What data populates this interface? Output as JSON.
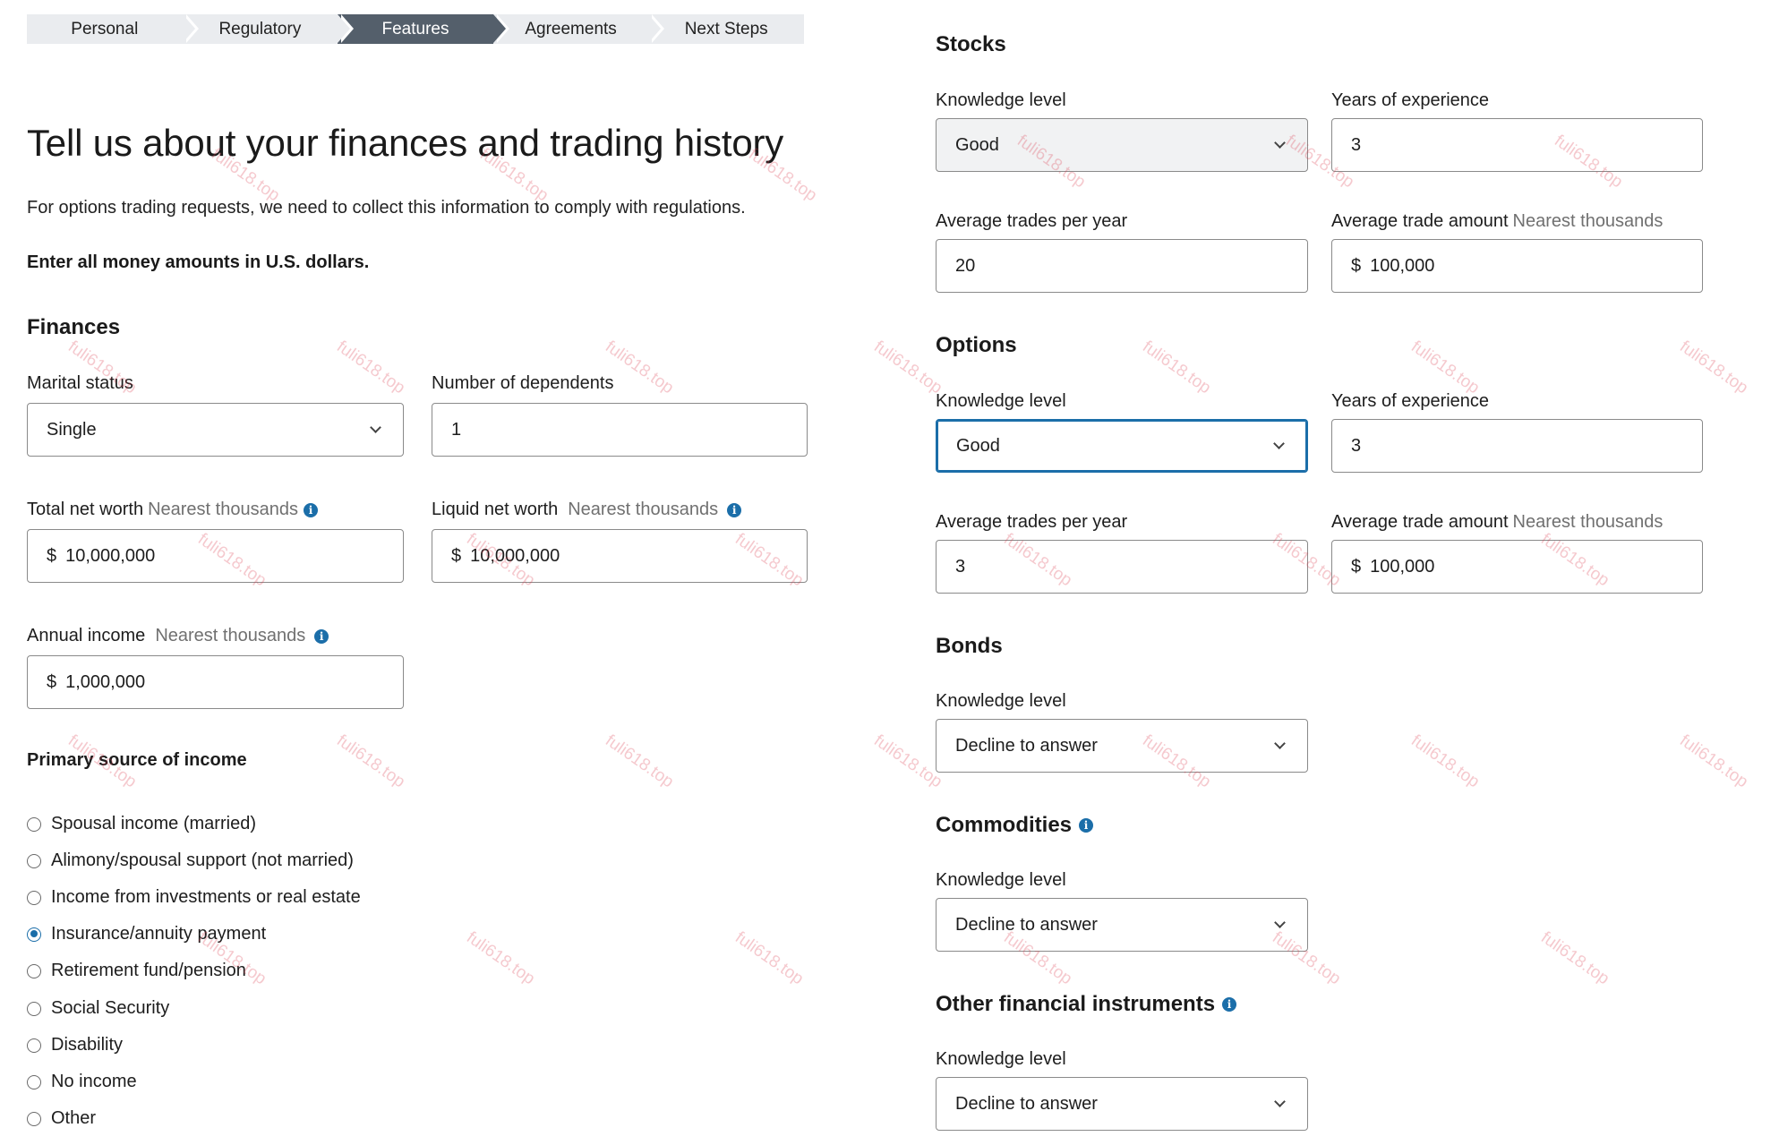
{
  "stepper": [
    "Personal",
    "Regulatory",
    "Features",
    "Agreements",
    "Next Steps"
  ],
  "page": {
    "title": "Tell us about your finances and trading history",
    "lead": "For options trading requests, we need to collect this information to comply with regulations.",
    "note": "Enter all money amounts in U.S. dollars."
  },
  "finances": {
    "heading": "Finances",
    "marital_label": "Marital status",
    "marital_value": "Single",
    "dependents_label": "Number of dependents",
    "dependents_value": "1",
    "total_label": "Total net worth",
    "total_hint": "Nearest thousands",
    "total_currency": "$",
    "total_value": "10,000,000",
    "liquid_label": "Liquid net worth",
    "liquid_hint": "Nearest thousands",
    "liquid_currency": "$",
    "liquid_value": "10,000,000",
    "income_label": "Annual income",
    "income_hint": "Nearest thousands",
    "income_currency": "$",
    "income_value": "1,000,000"
  },
  "income_source": {
    "heading": "Primary source of income",
    "selected": "Insurance/annuity payment",
    "options": [
      "Spousal income (married)",
      "Alimony/spousal support (not married)",
      "Income from investments or real estate",
      "Insurance/annuity payment",
      "Retirement fund/pension",
      "Social Security",
      "Disability",
      "No income",
      "Other"
    ]
  },
  "stocks": {
    "heading": "Stocks",
    "knowledge_label": "Knowledge level",
    "knowledge_value": "Good",
    "years_label": "Years of experience",
    "years_value": "3",
    "trades_label": "Average trades per year",
    "trades_value": "20",
    "amount_label": "Average trade amount",
    "amount_hint": "Nearest thousands",
    "amount_currency": "$",
    "amount_value": "100,000"
  },
  "options": {
    "heading": "Options",
    "knowledge_label": "Knowledge level",
    "knowledge_value": "Good",
    "years_label": "Years of experience",
    "years_value": "3",
    "trades_label": "Average trades per year",
    "trades_value": "3",
    "amount_label": "Average trade amount",
    "amount_hint": "Nearest thousands",
    "amount_currency": "$",
    "amount_value": "100,000"
  },
  "bonds": {
    "heading": "Bonds",
    "knowledge_label": "Knowledge level",
    "knowledge_value": "Decline to answer"
  },
  "commodities": {
    "heading": "Commodities",
    "knowledge_label": "Knowledge level",
    "knowledge_value": "Decline to answer"
  },
  "other": {
    "heading": "Other financial instruments",
    "knowledge_label": "Knowledge level",
    "knowledge_value": "Decline to answer"
  },
  "watermark": "fuli618.top",
  "colors": {
    "accent": "#1b6ea9",
    "stepper_active": "#545f6b",
    "stepper_inactive": "#eaecef",
    "hint": "#707070"
  }
}
